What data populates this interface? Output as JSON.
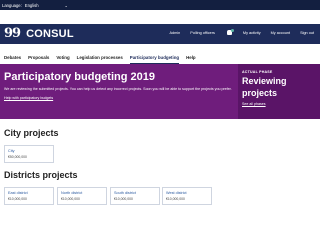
{
  "language_bar": {
    "label": "Language:",
    "selected": "English"
  },
  "header": {
    "logo_mark": "99",
    "logo_text": "CONSUL",
    "links": {
      "admin": "Admin",
      "polling_officers": "Polling officers",
      "my_activity": "My activity",
      "my_account": "My account",
      "sign_out": "Sign out"
    }
  },
  "nav": {
    "items": [
      {
        "label": "Debates"
      },
      {
        "label": "Proposals"
      },
      {
        "label": "Voting"
      },
      {
        "label": "Legislation processes"
      },
      {
        "label": "Participatory budgeting"
      },
      {
        "label": "Help"
      }
    ]
  },
  "hero": {
    "title": "Participatory budgeting 2019",
    "description": "We are reviewing the submitted projects. You can help us detect any incorrect projects. Soon you will be able to support the projects you prefer.",
    "help_link": "Help with participatory budgets",
    "phase_label": "ACTUAL PHASE",
    "phase_name": "Reviewing projects",
    "phases_link": "See all phases"
  },
  "city": {
    "title": "City projects",
    "cards": [
      {
        "name": "City",
        "amount": "€50,000,000"
      }
    ]
  },
  "districts": {
    "title": "Districts projects",
    "cards": [
      {
        "name": "East district",
        "amount": "€10,000,000"
      },
      {
        "name": "North district",
        "amount": "€10,000,000"
      },
      {
        "name": "South district",
        "amount": "€10,000,000"
      },
      {
        "name": "West district",
        "amount": "€10,000,000"
      }
    ]
  },
  "colors": {
    "header": "#1e2c5a",
    "hero": "#6f1d7c",
    "phase": "#5a1467",
    "accent": "#5ab5a5"
  }
}
